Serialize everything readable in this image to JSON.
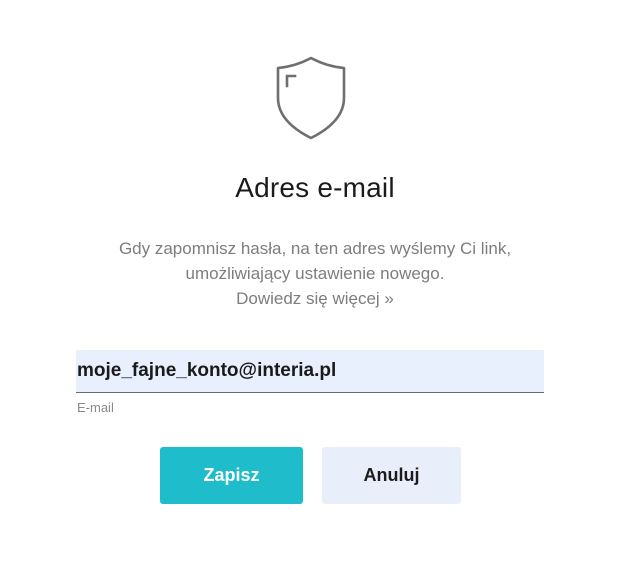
{
  "icons": {
    "header_icon": "shield-icon"
  },
  "header": {
    "title": "Adres e-mail"
  },
  "description": {
    "line1": "Gdy zapomnisz hasła, na ten adres wyślemy Ci link,",
    "line2": "umożliwiający ustawienie nowego.",
    "learn_more_link": "Dowiedz się więcej »"
  },
  "email_field": {
    "value": "moje_fajne_konto@interia.pl",
    "label": "E-mail"
  },
  "buttons": {
    "save_label": "Zapisz",
    "cancel_label": "Anuluj"
  },
  "colors": {
    "accent": "#1fbccb",
    "cancel_bg": "#e9eefb",
    "input_bg": "#e8f0fe"
  }
}
